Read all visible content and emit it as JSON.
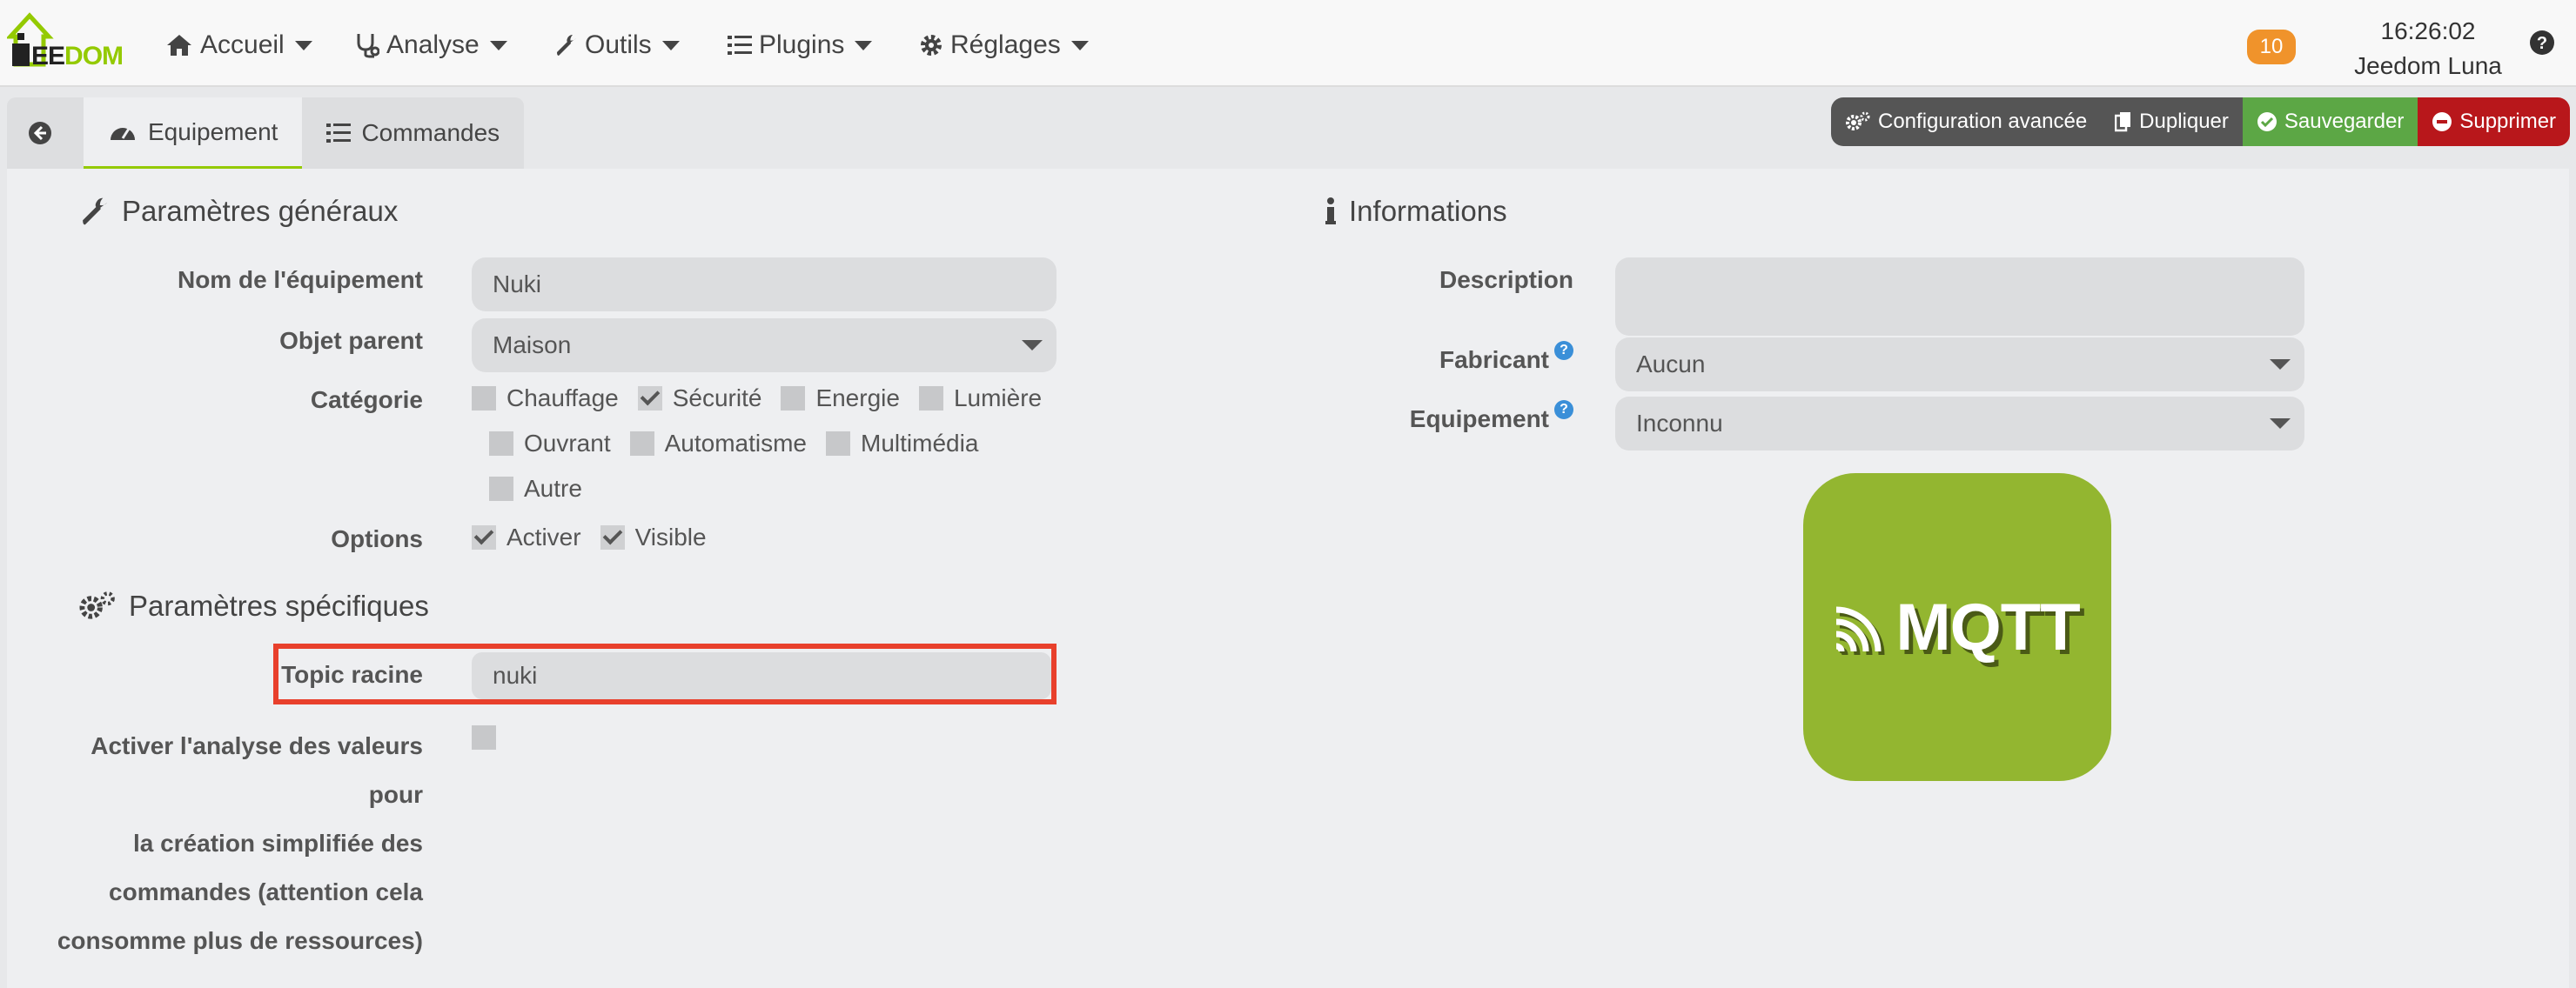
{
  "brand": {
    "logo_part1": "EE",
    "logo_part2": "DOM"
  },
  "nav": {
    "items": [
      {
        "label": "Accueil",
        "icon": "home-icon"
      },
      {
        "label": "Analyse",
        "icon": "stethoscope-icon"
      },
      {
        "label": "Outils",
        "icon": "wrench-icon"
      },
      {
        "label": "Plugins",
        "icon": "list-icon"
      },
      {
        "label": "Réglages",
        "icon": "gear-icon"
      }
    ],
    "notifications": "10",
    "time": "16:26:02",
    "user": "Jeedom Luna"
  },
  "tabs": {
    "equipement": "Equipement",
    "commandes": "Commandes"
  },
  "actions": {
    "config": "Configuration avancée",
    "duplicate": "Dupliquer",
    "save": "Sauvegarder",
    "delete": "Supprimer"
  },
  "general": {
    "title": "Paramètres généraux",
    "name_label": "Nom de l'équipement",
    "name_value": "Nuki",
    "parent_label": "Objet parent",
    "parent_value": "Maison",
    "category_label": "Catégorie",
    "categories": [
      {
        "label": "Chauffage",
        "checked": false
      },
      {
        "label": "Sécurité",
        "checked": true
      },
      {
        "label": "Energie",
        "checked": false
      },
      {
        "label": "Lumière",
        "checked": false
      },
      {
        "label": "Ouvrant",
        "checked": false
      },
      {
        "label": "Automatisme",
        "checked": false
      },
      {
        "label": "Multimédia",
        "checked": false
      },
      {
        "label": "Autre",
        "checked": false
      }
    ],
    "options_label": "Options",
    "opt_activate": "Activer",
    "opt_visible": "Visible"
  },
  "specific": {
    "title": "Paramètres spécifiques",
    "topic_label": "Topic racine",
    "topic_value": "nuki",
    "analysis_label_1": "Activer l'analyse des valeurs pour",
    "analysis_label_2": "la création simplifiée des",
    "analysis_label_3": "commandes (attention cela",
    "analysis_label_4": "consomme plus de ressources)"
  },
  "info": {
    "title": "Informations",
    "description_label": "Description",
    "description_value": "",
    "manufacturer_label": "Fabricant",
    "manufacturer_value": "Aucun",
    "device_label": "Equipement",
    "device_value": "Inconnu",
    "logo_text": "MQTT"
  }
}
